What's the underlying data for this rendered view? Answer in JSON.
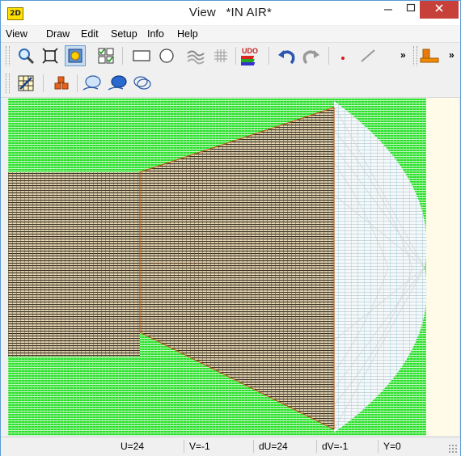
{
  "window": {
    "title_view": "View",
    "title_mode": "*IN AIR*",
    "app_icon_text": "2D"
  },
  "menu": [
    "View",
    "Draw",
    "Edit",
    "Setup",
    "Info",
    "Help"
  ],
  "toolbar": {
    "udo_label": "UDO",
    "overflow_label": "»",
    "icons": [
      "zoom-icon",
      "fit-view-icon",
      "highlight-icon",
      "checklist-icon",
      "rectangle-icon",
      "circle-icon",
      "surface-icon",
      "grid-icon",
      "udo-icon",
      "undo-icon",
      "redo-icon",
      "point-icon",
      "line-icon",
      "stack-icon"
    ]
  },
  "toolbar2": {
    "icons": [
      "mesh-edit-icon",
      "cubes-icon",
      "ellipse-single-icon",
      "ellipse-double-icon",
      "ellipse-overlap-icon"
    ]
  },
  "status": {
    "u": "U=24",
    "v": "V=-1",
    "du": "dU=24",
    "dv": "dV=-1",
    "y": "Y=0"
  },
  "colors": {
    "mesh_green": "#22dd22",
    "mesh_dark": "#2a2418",
    "wireframe": "#c8c8c8",
    "outline": "#b85a14",
    "canvas_bg": "#fffbe8"
  }
}
